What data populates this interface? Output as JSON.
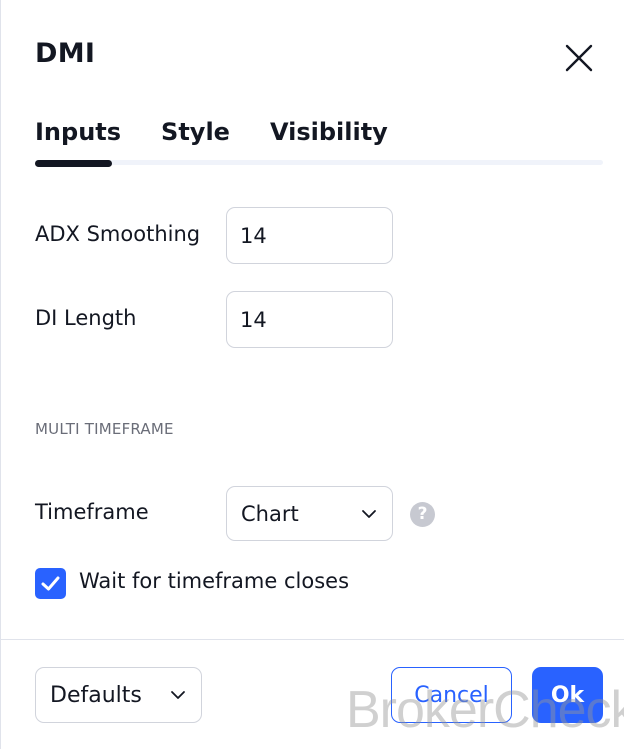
{
  "dialog": {
    "title": "DMI",
    "close_icon": "close-icon"
  },
  "tabs": [
    {
      "label": "Inputs",
      "active": true
    },
    {
      "label": "Style",
      "active": false
    },
    {
      "label": "Visibility",
      "active": false
    }
  ],
  "inputs": {
    "adx_smoothing": {
      "label": "ADX Smoothing",
      "value": "14"
    },
    "di_length": {
      "label": "DI Length",
      "value": "14"
    }
  },
  "multi_timeframe": {
    "section_title": "MULTI TIMEFRAME",
    "timeframe": {
      "label": "Timeframe",
      "value": "Chart",
      "icon": "chevron-down-icon"
    },
    "help_icon": "question-circle-icon",
    "wait_for_close": {
      "label": "Wait for timeframe closes",
      "checked": true
    }
  },
  "footer": {
    "defaults_label": "Defaults",
    "cancel_label": "Cancel",
    "ok_label": "Ok"
  },
  "watermark": "BrokerCheck",
  "colors": {
    "accent": "#2962ff",
    "text": "#131722",
    "border": "#d1d4dc",
    "muted": "#6a6d78"
  }
}
